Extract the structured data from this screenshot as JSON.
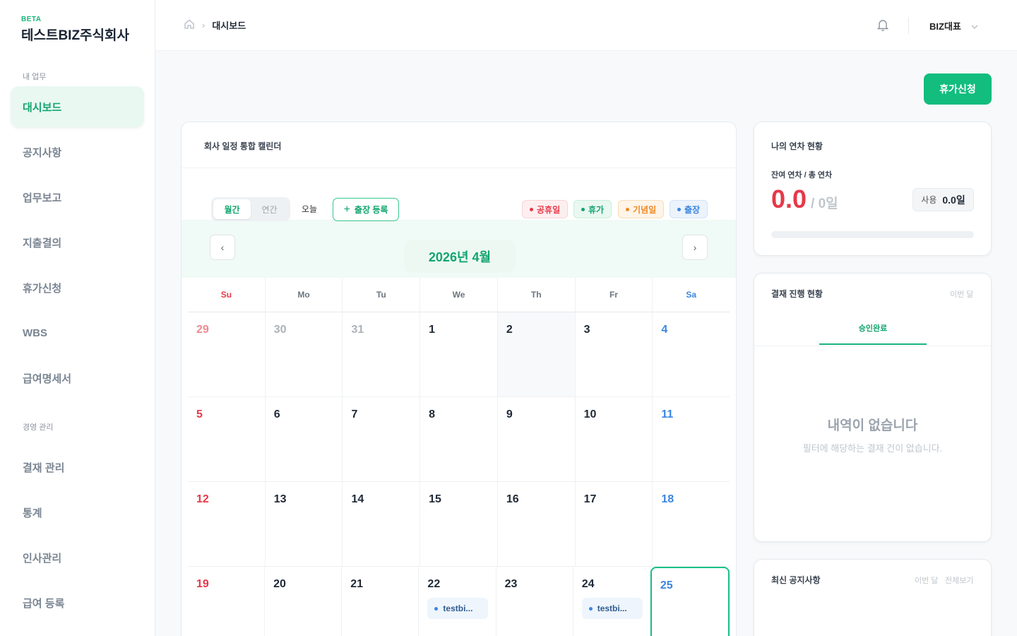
{
  "sidebar": {
    "beta": "BETA",
    "company": "테스트BIZ주식회사",
    "section_my": "내 업무",
    "section_mgmt": "경영 관리",
    "items": [
      {
        "label": "대시보드"
      },
      {
        "label": "공지사항"
      },
      {
        "label": "업무보고"
      },
      {
        "label": "지출결의"
      },
      {
        "label": "휴가신청"
      },
      {
        "label": "WBS"
      },
      {
        "label": "급여명세서"
      },
      {
        "label": "결재 관리"
      },
      {
        "label": "통계"
      },
      {
        "label": "인사관리"
      },
      {
        "label": "급여 등록"
      }
    ]
  },
  "header": {
    "breadcrumb": "대시보드",
    "user": "BIZ대표"
  },
  "apply_button": "휴가신청",
  "calendar": {
    "title": "회사 일정 통합 캘린더",
    "view_monthly": "월간",
    "view_yearly": "연간",
    "today": "오늘",
    "register_trip": "출장 등록",
    "legend": [
      {
        "label": "공휴일",
        "color": "#e53949"
      },
      {
        "label": "휴가",
        "color": "#12a56e"
      },
      {
        "label": "기념일",
        "color": "#f08a24"
      },
      {
        "label": "출장",
        "color": "#3b86e0"
      }
    ],
    "month_label": "2026년 4월",
    "weekdays": [
      "Su",
      "Mo",
      "Tu",
      "We",
      "Th",
      "Fr",
      "Sa"
    ],
    "weeks": [
      [
        "29",
        "30",
        "31",
        "1",
        "2",
        "3",
        "4"
      ],
      [
        "5",
        "6",
        "7",
        "8",
        "9",
        "10",
        "11"
      ],
      [
        "12",
        "13",
        "14",
        "15",
        "16",
        "17",
        "18"
      ],
      [
        "19",
        "20",
        "21",
        "22",
        "23",
        "24",
        "25"
      ]
    ],
    "events": [
      {
        "label": "testbi..."
      },
      {
        "label": "testbi..."
      }
    ]
  },
  "leave_card": {
    "title": "나의 연차 현황",
    "subtitle": "잔여 연차 / 총 연차",
    "remaining": "0.0",
    "total": "/ 0일",
    "used_label": "사용",
    "used_value": "0.0일",
    "used_fraction": 0
  },
  "approval_card": {
    "title": "결재 진행 현황",
    "period": "이번 달",
    "tab": "승인완료",
    "empty_title": "내역이 없습니다",
    "empty_sub": "필터에 해당하는 결재 건이 없습니다."
  },
  "notice_card": {
    "title": "최신 공지사항",
    "period": "이번 달",
    "view_all": "전체보기"
  }
}
